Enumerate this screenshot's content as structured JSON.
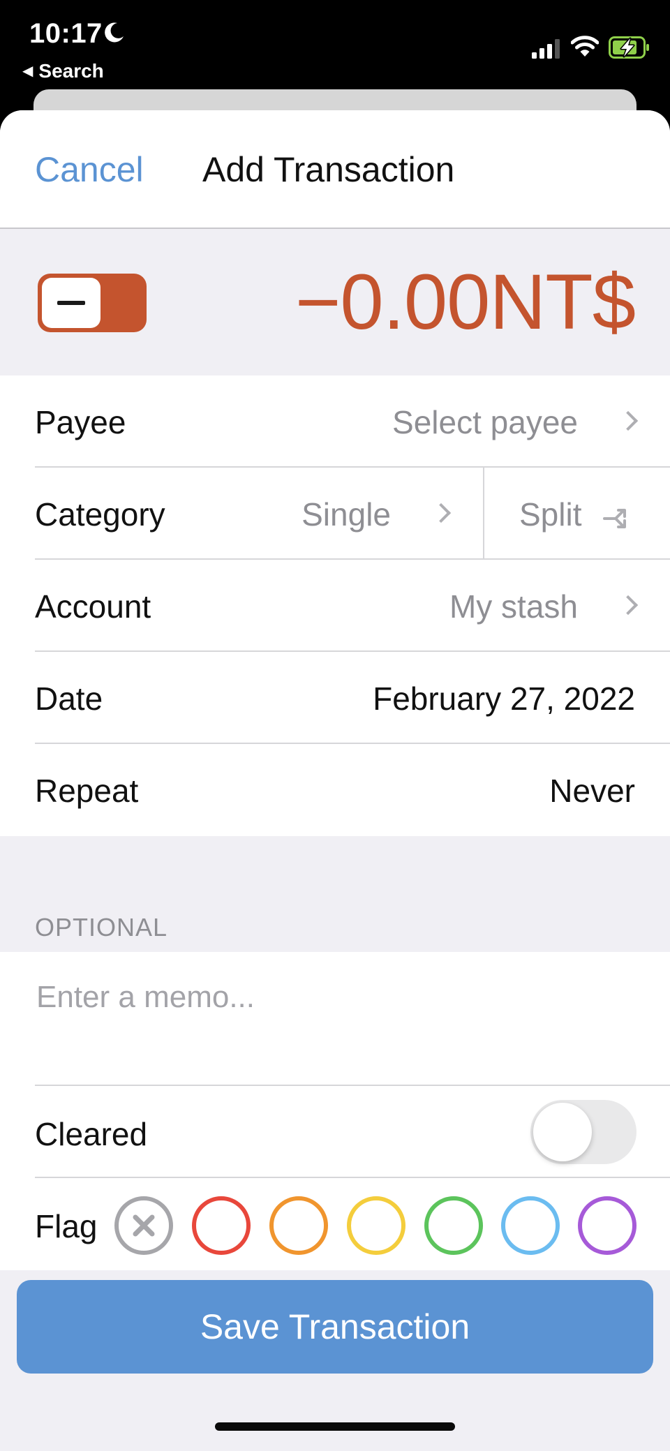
{
  "status_bar": {
    "time": "10:17",
    "back_label": "Search",
    "icons": [
      "moon-icon",
      "cellular-signal-icon",
      "wifi-icon",
      "battery-charging-icon"
    ]
  },
  "nav": {
    "cancel_label": "Cancel",
    "title": "Add Transaction"
  },
  "amount": {
    "display": "−0.00NT$",
    "sign": "negative",
    "color": "#c4542e"
  },
  "rows": {
    "payee": {
      "label": "Payee",
      "value": "Select payee"
    },
    "category": {
      "label": "Category",
      "value": "Single",
      "split_label": "Split"
    },
    "account": {
      "label": "Account",
      "value": "My stash"
    },
    "date": {
      "label": "Date",
      "value": "February 27, 2022"
    },
    "repeat": {
      "label": "Repeat",
      "value": "Never"
    }
  },
  "optional": {
    "header": "OPTIONAL",
    "memo_placeholder": "Enter a memo...",
    "cleared_label": "Cleared",
    "cleared_on": false,
    "flag_label": "Flag",
    "flags": [
      {
        "name": "none",
        "color": "#a6a6aa"
      },
      {
        "name": "red",
        "color": "#e8473b"
      },
      {
        "name": "orange",
        "color": "#f0952e"
      },
      {
        "name": "yellow",
        "color": "#f4cd3c"
      },
      {
        "name": "green",
        "color": "#5cc45c"
      },
      {
        "name": "blue",
        "color": "#6bbcf0"
      },
      {
        "name": "purple",
        "color": "#a65ad8"
      }
    ]
  },
  "save_label": "Save Transaction",
  "colors": {
    "accent": "#5b93d3",
    "negative": "#c4542e",
    "background": "#f0eff4"
  }
}
